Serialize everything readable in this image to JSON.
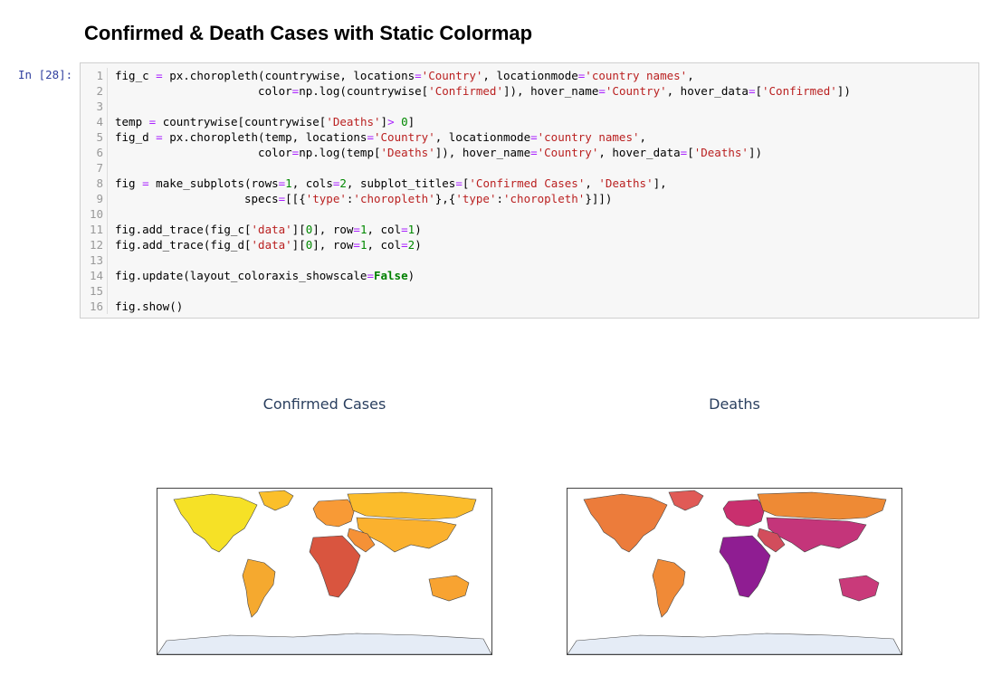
{
  "heading": "Confirmed & Death Cases with Static Colormap",
  "prompt": "In [28]:",
  "code_lines": [
    {
      "n": "1",
      "tokens": [
        [
          "",
          "fig_c "
        ],
        [
          "o",
          "="
        ],
        [
          "",
          " px.choropleth(countrywise, locations"
        ],
        [
          "o",
          "="
        ],
        [
          "s",
          "'Country'"
        ],
        [
          "",
          ", locationmode"
        ],
        [
          "o",
          "="
        ],
        [
          "s",
          "'country names'"
        ],
        [
          "",
          ","
        ]
      ]
    },
    {
      "n": "2",
      "tokens": [
        [
          "",
          "                     color"
        ],
        [
          "o",
          "="
        ],
        [
          "",
          "np.log(countrywise["
        ],
        [
          "s",
          "'Confirmed'"
        ],
        [
          "",
          "]), hover_name"
        ],
        [
          "o",
          "="
        ],
        [
          "s",
          "'Country'"
        ],
        [
          "",
          ", hover_data"
        ],
        [
          "o",
          "="
        ],
        [
          "",
          "["
        ],
        [
          "s",
          "'Confirmed'"
        ],
        [
          "",
          "])"
        ]
      ]
    },
    {
      "n": "3",
      "tokens": []
    },
    {
      "n": "4",
      "tokens": [
        [
          "",
          "temp "
        ],
        [
          "o",
          "="
        ],
        [
          "",
          " countrywise[countrywise["
        ],
        [
          "s",
          "'Deaths'"
        ],
        [
          "",
          "]"
        ],
        [
          "o",
          ">"
        ],
        [
          "",
          " "
        ],
        [
          "n",
          "0"
        ],
        [
          "",
          "]"
        ]
      ]
    },
    {
      "n": "5",
      "tokens": [
        [
          "",
          "fig_d "
        ],
        [
          "o",
          "="
        ],
        [
          "",
          " px.choropleth(temp, locations"
        ],
        [
          "o",
          "="
        ],
        [
          "s",
          "'Country'"
        ],
        [
          "",
          ", locationmode"
        ],
        [
          "o",
          "="
        ],
        [
          "s",
          "'country names'"
        ],
        [
          "",
          ","
        ]
      ]
    },
    {
      "n": "6",
      "tokens": [
        [
          "",
          "                     color"
        ],
        [
          "o",
          "="
        ],
        [
          "",
          "np.log(temp["
        ],
        [
          "s",
          "'Deaths'"
        ],
        [
          "",
          "]), hover_name"
        ],
        [
          "o",
          "="
        ],
        [
          "s",
          "'Country'"
        ],
        [
          "",
          ", hover_data"
        ],
        [
          "o",
          "="
        ],
        [
          "",
          "["
        ],
        [
          "s",
          "'Deaths'"
        ],
        [
          "",
          "])"
        ]
      ]
    },
    {
      "n": "7",
      "tokens": []
    },
    {
      "n": "8",
      "tokens": [
        [
          "",
          "fig "
        ],
        [
          "o",
          "="
        ],
        [
          "",
          " make_subplots(rows"
        ],
        [
          "o",
          "="
        ],
        [
          "n",
          "1"
        ],
        [
          "",
          ", cols"
        ],
        [
          "o",
          "="
        ],
        [
          "n",
          "2"
        ],
        [
          "",
          ", subplot_titles"
        ],
        [
          "o",
          "="
        ],
        [
          "",
          "["
        ],
        [
          "s",
          "'Confirmed Cases'"
        ],
        [
          "",
          ", "
        ],
        [
          "s",
          "'Deaths'"
        ],
        [
          "",
          "],"
        ]
      ]
    },
    {
      "n": "9",
      "tokens": [
        [
          "",
          "                   specs"
        ],
        [
          "o",
          "="
        ],
        [
          "",
          "[[{"
        ],
        [
          "s",
          "'type'"
        ],
        [
          "",
          ":"
        ],
        [
          "s",
          "'choropleth'"
        ],
        [
          "",
          "},{"
        ],
        [
          "s",
          "'type'"
        ],
        [
          "",
          ":"
        ],
        [
          "s",
          "'choropleth'"
        ],
        [
          "",
          "}]])"
        ]
      ]
    },
    {
      "n": "10",
      "tokens": []
    },
    {
      "n": "11",
      "tokens": [
        [
          "",
          "fig.add_trace(fig_c["
        ],
        [
          "s",
          "'data'"
        ],
        [
          "",
          "]["
        ],
        [
          "n",
          "0"
        ],
        [
          "",
          "], row"
        ],
        [
          "o",
          "="
        ],
        [
          "n",
          "1"
        ],
        [
          "",
          ", col"
        ],
        [
          "o",
          "="
        ],
        [
          "n",
          "1"
        ],
        [
          "",
          ")"
        ]
      ]
    },
    {
      "n": "12",
      "tokens": [
        [
          "",
          "fig.add_trace(fig_d["
        ],
        [
          "s",
          "'data'"
        ],
        [
          "",
          "]["
        ],
        [
          "n",
          "0"
        ],
        [
          "",
          "], row"
        ],
        [
          "o",
          "="
        ],
        [
          "n",
          "1"
        ],
        [
          "",
          ", col"
        ],
        [
          "o",
          "="
        ],
        [
          "n",
          "2"
        ],
        [
          "",
          ")"
        ]
      ]
    },
    {
      "n": "13",
      "tokens": []
    },
    {
      "n": "14",
      "tokens": [
        [
          "",
          "fig.update(layout_coloraxis_showscale"
        ],
        [
          "o",
          "="
        ],
        [
          "k",
          "False"
        ],
        [
          "",
          ")"
        ]
      ]
    },
    {
      "n": "15",
      "tokens": []
    },
    {
      "n": "16",
      "tokens": [
        [
          "",
          "fig.show()"
        ]
      ]
    }
  ],
  "subplots": [
    {
      "title": "Confirmed Cases",
      "palette": {
        "north_america": "#f6e126",
        "greenland": "#fbbf2a",
        "south_america": "#f5a92f",
        "europe": "#f89a36",
        "russia": "#fbbc2b",
        "asia": "#fbb12e",
        "middle_east": "#f59136",
        "africa": "#d9553f",
        "australia": "#f8a331",
        "antarctica": "#e5ecf6"
      }
    },
    {
      "title": "Deaths",
      "palette": {
        "north_america": "#ec7c3b",
        "greenland": "#e05a56",
        "south_america": "#f08a37",
        "europe": "#c92f6e",
        "russia": "#ee8a35",
        "asia": "#c4357a",
        "middle_east": "#d24d5c",
        "africa": "#8f1d92",
        "australia": "#c93a7a",
        "antarctica": "#e5ecf6"
      }
    }
  ]
}
